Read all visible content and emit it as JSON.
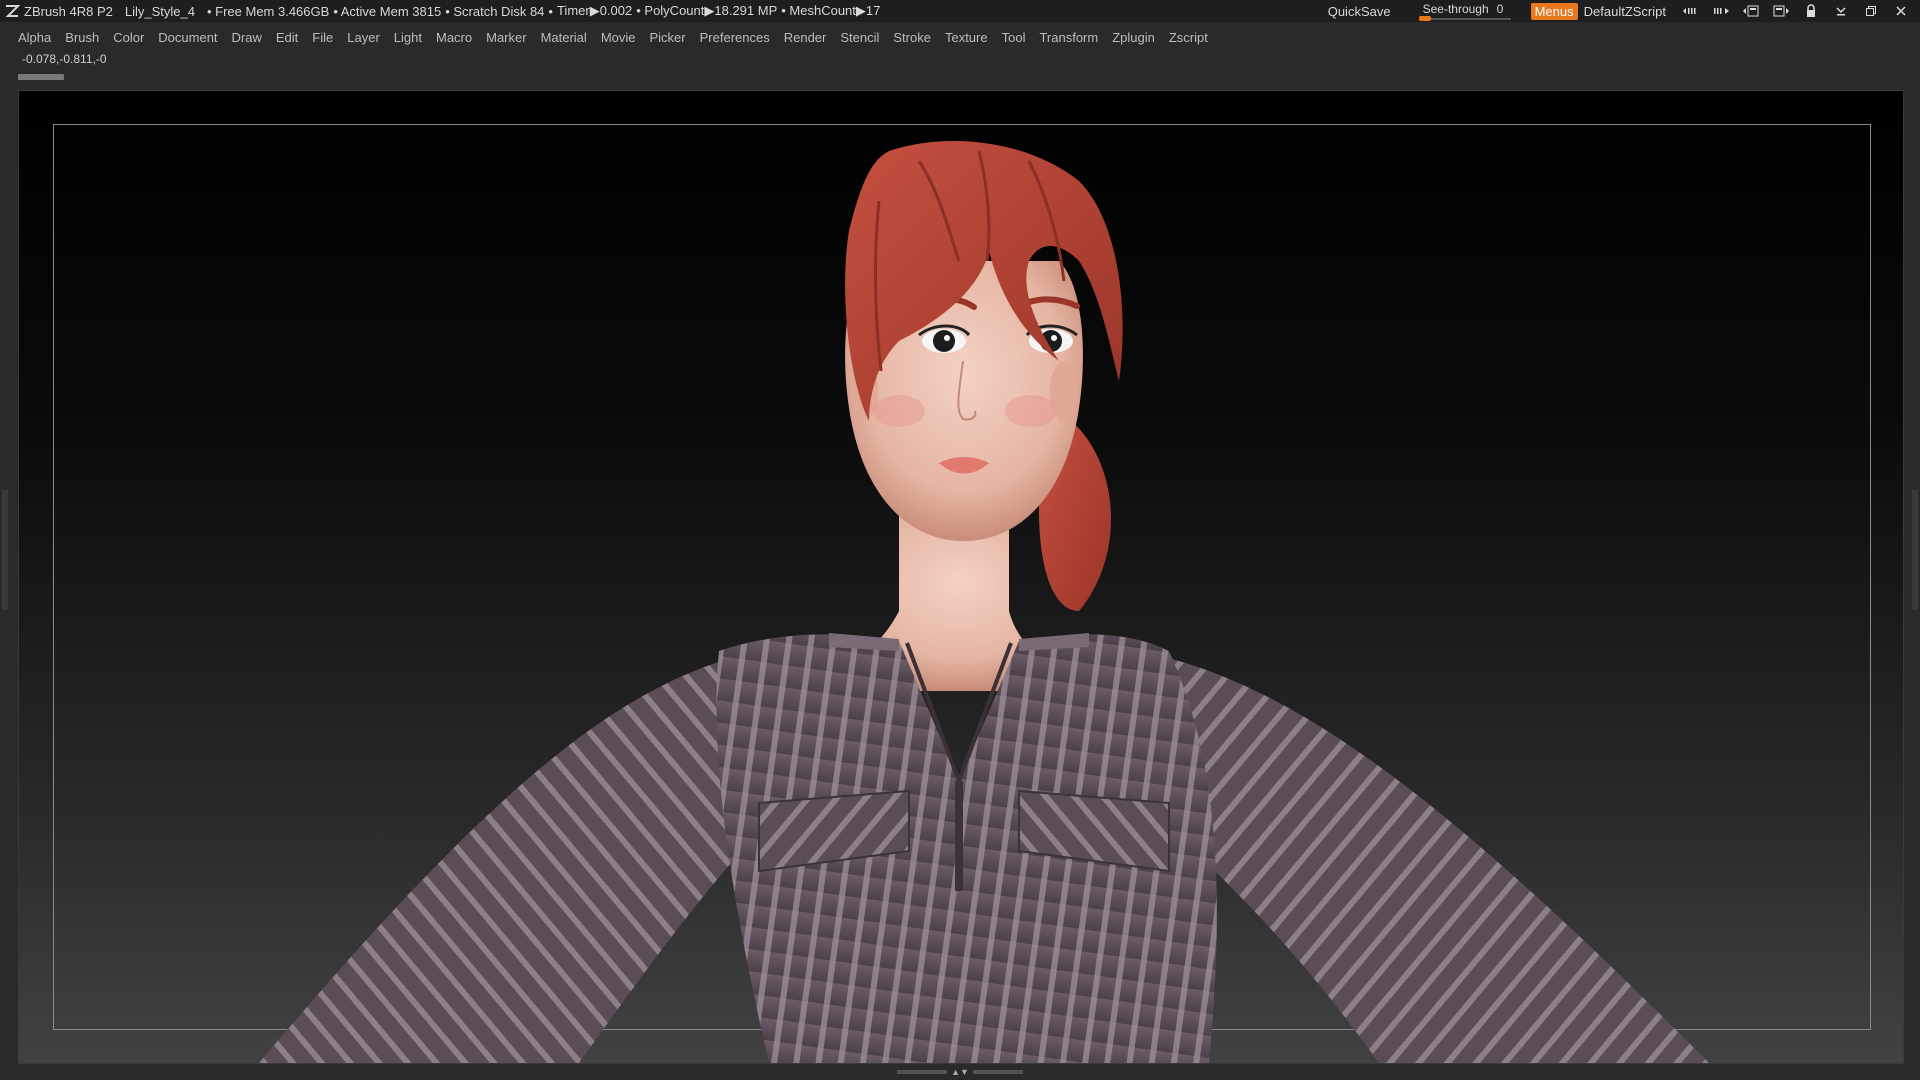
{
  "titlebar": {
    "app": "ZBrush 4R8 P2",
    "document": "Lily_Style_4",
    "status": [
      "• Free Mem 3.466GB",
      "• Active Mem 3815",
      "• Scratch Disk 84",
      "•",
      "Timer▶0.002",
      "• PolyCount▶18.291 MP",
      "• MeshCount▶17"
    ],
    "quicksave": "QuickSave",
    "see_through_label": "See-through",
    "see_through_value": "0",
    "see_through_level": 0,
    "menus": "Menus",
    "default_zscript": "DefaultZScript",
    "accent": "#e8791f"
  },
  "menubar": {
    "items": [
      "Alpha",
      "Brush",
      "Color",
      "Document",
      "Draw",
      "Edit",
      "File",
      "Layer",
      "Light",
      "Macro",
      "Marker",
      "Material",
      "Movie",
      "Picker",
      "Preferences",
      "Render",
      "Stencil",
      "Stroke",
      "Texture",
      "Tool",
      "Transform",
      "Zplugin",
      "Zscript"
    ]
  },
  "coords": "-0.078,-0.811,-0",
  "icons": {
    "logo": "zbrush-logo-icon",
    "window": [
      "hide-palettes-icon",
      "toggle-layout-icon",
      "popup-icon",
      "dock-icon",
      "lock-icon",
      "minimize-icon",
      "restore-icon",
      "close-icon"
    ]
  }
}
